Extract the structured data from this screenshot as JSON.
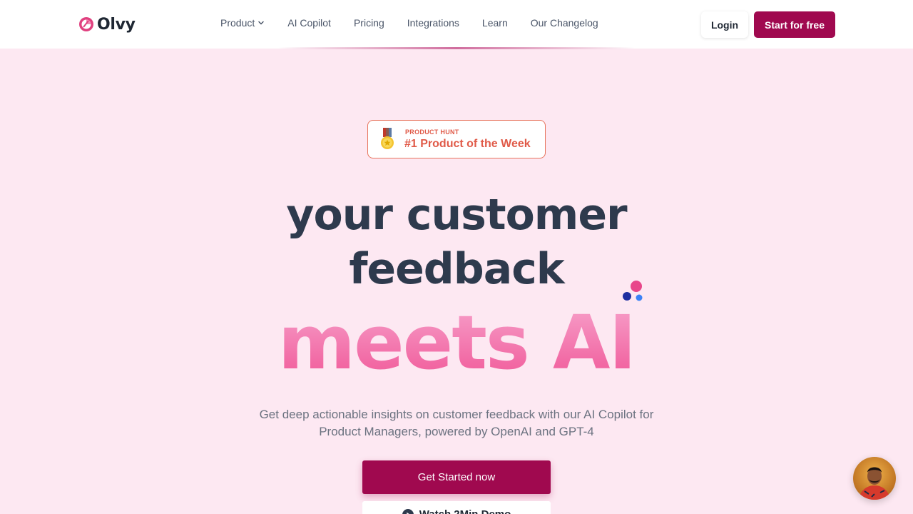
{
  "header": {
    "logo_text": "Olvy",
    "nav": [
      {
        "label": "Product"
      },
      {
        "label": "AI Copilot"
      },
      {
        "label": "Pricing"
      },
      {
        "label": "Integrations"
      },
      {
        "label": "Learn"
      },
      {
        "label": "Our Changelog"
      }
    ],
    "login_label": "Login",
    "start_label": "Start for free"
  },
  "badge": {
    "small": "PRODUCT HUNT",
    "big": "#1 Product of the Week"
  },
  "hero": {
    "line1": "your customer",
    "line2": "feedback",
    "line3": "meets AI",
    "subtitle": "Get deep actionable insights on customer feedback with our AI Copilot for Product Managers, powered by OpenAI and GPT-4",
    "cta_label": "Get Started now",
    "demo_label": "Watch 2Min Demo"
  },
  "colors": {
    "brand": "#a0094f",
    "background": "#fde8f2",
    "badge_accent": "#e05a48",
    "headline": "#2e3a4d"
  },
  "icons": [
    "olvy-logo-icon",
    "chevron-down-icon",
    "medal-icon",
    "dots-icon",
    "play-icon",
    "chat-avatar"
  ]
}
